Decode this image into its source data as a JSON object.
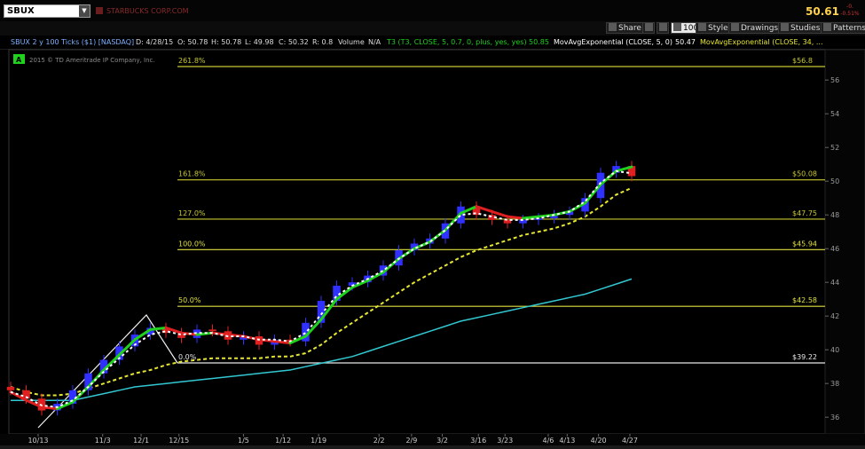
{
  "header": {
    "symbol": "SBUX",
    "company": "STARBUCKS CORP.COM",
    "last_price": "50.61",
    "change_top": "-0.",
    "change_bottom": "-0.51%"
  },
  "toolbar": {
    "share": "Share",
    "zoom": "100",
    "style": "Style",
    "drawings": "Drawings",
    "studies": "Studies",
    "patterns": "Patterns"
  },
  "studybar": {
    "title": "SBUX 2 y 100 Ticks ($1) [NASDAQ]",
    "date": "D: 4/28/15",
    "open": "O: 50.78",
    "high": "H: 50.78",
    "low": "L: 49.98",
    "close": "C: 50.32",
    "range": "R: 0.8",
    "vol_label": "Volume",
    "vol_value": "N/A",
    "t3_label": "T3 (T3, CLOSE, 5, 0.7, 0, plus, yes, yes)",
    "t3_value": "50.85",
    "ema1_label": "MovAvgExponential (CLOSE, 5, 0)",
    "ema1_value": "50.47",
    "ema2_label": "MovAvgExponential (CLOSE, 34, ..."
  },
  "chart_data": {
    "type": "line",
    "badge": "A",
    "watermark": "2015 © TD Ameritrade IP Company, Inc.",
    "ylim": [
      34.9,
      57.9
    ],
    "y_ticks": [
      "36",
      "38",
      "40",
      "42",
      "44",
      "46",
      "48",
      "50",
      "52",
      "54",
      "56"
    ],
    "x_ticks": [
      "10/13",
      "11/3",
      "12/1",
      "12/15",
      "1/5",
      "1/12",
      "1/19",
      "2/2",
      "2/9",
      "3/2",
      "3/16",
      "3/23",
      "4/6",
      "4/13",
      "4/20",
      "4/27"
    ],
    "fib_levels": [
      {
        "label": "261.8%",
        "price": "$56.8",
        "value": 56.8,
        "color": "#c8c832"
      },
      {
        "label": "161.8%",
        "price": "$50.08",
        "value": 50.08,
        "color": "#c8c832"
      },
      {
        "label": "127.0%",
        "price": "$47.75",
        "value": 47.75,
        "color": "#c8c832"
      },
      {
        "label": "100.0%",
        "price": "$45.94",
        "value": 45.94,
        "color": "#e0e040"
      },
      {
        "label": "50.0%",
        "price": "$42.58",
        "value": 42.58,
        "color": "#e0e040"
      },
      {
        "label": "0.0%",
        "price": "$39.22",
        "value": 39.22,
        "color": "#e8e8e8"
      }
    ],
    "close": [
      37.6,
      37.1,
      36.4,
      36.8,
      37.6,
      38.6,
      39.4,
      40.2,
      40.9,
      41.3,
      41.0,
      40.7,
      41.2,
      41.1,
      40.6,
      40.8,
      40.3,
      40.6,
      40.5,
      41.6,
      42.9,
      43.8,
      44.0,
      44.4,
      45.0,
      45.9,
      46.3,
      46.6,
      47.5,
      48.5,
      48.0,
      47.7,
      47.5,
      47.7,
      47.8,
      48.0,
      48.2,
      49.0,
      50.5,
      50.9,
      50.3
    ],
    "t3": [
      37.5,
      37.0,
      36.6,
      36.5,
      36.9,
      37.8,
      38.8,
      39.7,
      40.6,
      41.2,
      41.3,
      41.0,
      40.9,
      41.0,
      40.9,
      40.8,
      40.6,
      40.5,
      40.4,
      40.8,
      41.8,
      43.0,
      43.7,
      44.1,
      44.6,
      45.4,
      46.0,
      46.4,
      47.1,
      48.1,
      48.5,
      48.2,
      47.9,
      47.8,
      47.9,
      48.0,
      48.2,
      48.7,
      49.8,
      50.6,
      50.85
    ],
    "ema5": [
      37.5,
      37.2,
      36.7,
      36.6,
      37.0,
      37.8,
      38.7,
      39.5,
      40.3,
      40.9,
      41.1,
      40.9,
      41.0,
      41.0,
      40.8,
      40.8,
      40.6,
      40.6,
      40.5,
      41.0,
      42.1,
      43.2,
      43.8,
      44.2,
      44.7,
      45.4,
      46.0,
      46.4,
      47.1,
      48.0,
      48.1,
      47.9,
      47.7,
      47.7,
      47.8,
      48.0,
      48.2,
      48.8,
      49.9,
      50.6,
      50.47
    ],
    "ema34": [
      37.8,
      37.5,
      37.3,
      37.3,
      37.4,
      37.7,
      38.0,
      38.3,
      38.6,
      38.8,
      39.1,
      39.3,
      39.4,
      39.5,
      39.5,
      39.5,
      39.5,
      39.6,
      39.6,
      39.8,
      40.3,
      41.0,
      41.6,
      42.2,
      42.8,
      43.4,
      44.0,
      44.5,
      45.0,
      45.5,
      45.9,
      46.2,
      46.5,
      46.8,
      47.0,
      47.2,
      47.5,
      47.9,
      48.5,
      49.2,
      49.6
    ],
    "ema_long": [
      37.0,
      37.0,
      37.0,
      37.0,
      37.0,
      37.2,
      37.4,
      37.6,
      37.8,
      37.9,
      38.0,
      38.1,
      38.2,
      38.3,
      38.4,
      38.5,
      38.6,
      38.7,
      38.8,
      39.0,
      39.2,
      39.4,
      39.6,
      39.9,
      40.2,
      40.5,
      40.8,
      41.1,
      41.4,
      41.7,
      41.9,
      42.1,
      42.3,
      42.5,
      42.7,
      42.9,
      43.1,
      43.3,
      43.6,
      43.9,
      44.2
    ]
  },
  "colors": {
    "up": "#3030ff",
    "down": "#e02020",
    "t3_up": "#1ed21e",
    "t3_down": "#e02020",
    "ema5": "#ffffff",
    "ema34": "#e6e632",
    "ema_long": "#32c8d2",
    "price_axis_text": "#9a9a9a"
  }
}
